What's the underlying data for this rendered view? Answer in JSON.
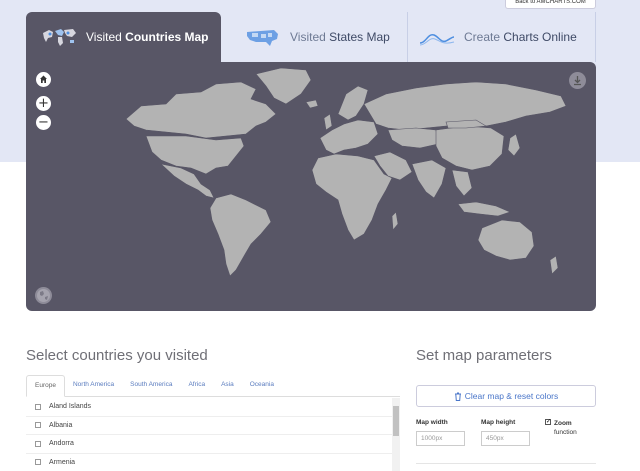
{
  "header": {
    "back_link": "Back to AMCHARTS.COM",
    "tabs": [
      {
        "prefix": "Visited",
        "bold": "Countries Map",
        "active": true
      },
      {
        "prefix": "Visited",
        "bold": "States Map",
        "active": false
      },
      {
        "prefix": "Create",
        "bold": "Charts Online",
        "active": false
      }
    ]
  },
  "map": {
    "controls": {
      "zoom_in": "+",
      "zoom_out": "−"
    },
    "colors": {
      "background": "#585666",
      "land": "#b3b3b3",
      "border": "#585666"
    }
  },
  "countries_section": {
    "title": "Select countries you visited",
    "regions": [
      "Europe",
      "North America",
      "South America",
      "Africa",
      "Asia",
      "Oceania"
    ],
    "active_region": "Europe",
    "countries": [
      "Aland Islands",
      "Albania",
      "Andorra",
      "Armenia"
    ]
  },
  "params_section": {
    "title": "Set map parameters",
    "clear_button": "Clear map & reset colors",
    "map_width_label": "Map width",
    "map_width_placeholder": "1000px",
    "map_height_label": "Map height",
    "map_height_placeholder": "450px",
    "zoom_label_bold": "Zoom",
    "zoom_label_rest": "function",
    "zoom_checked": true
  }
}
